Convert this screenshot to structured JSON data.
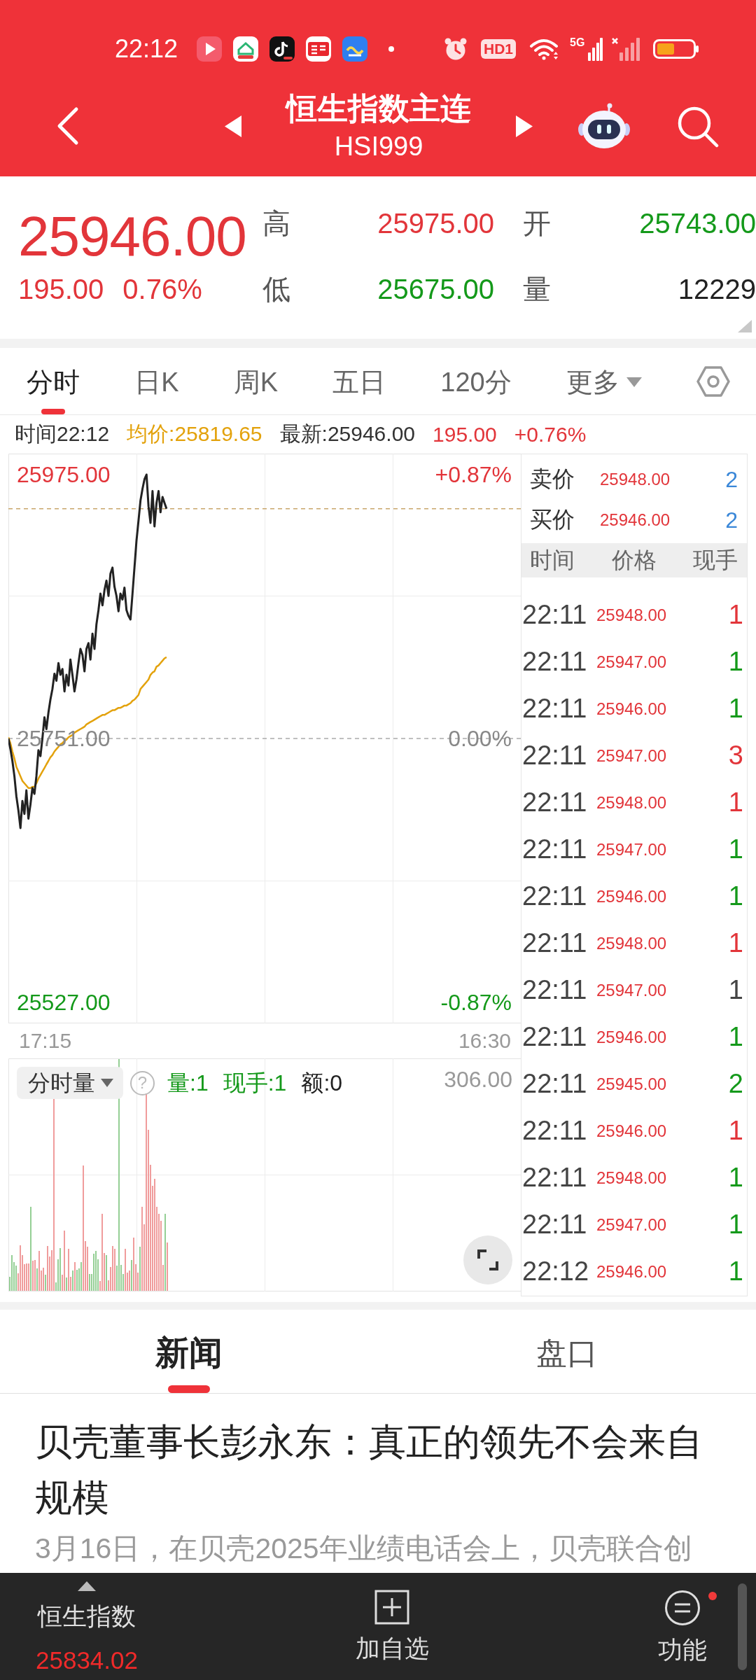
{
  "status_bar": {
    "time": "22:12",
    "hd_badge": "HD1",
    "network": "5G"
  },
  "header": {
    "title": "恒生指数主连",
    "code": "HSI999"
  },
  "quote": {
    "price": "25946.00",
    "change": "195.00",
    "change_percent": "0.76%",
    "rising": true,
    "stats": [
      {
        "label": "高",
        "value": "25975.00",
        "color": "#e2353a"
      },
      {
        "label": "开",
        "value": "25743.00",
        "color": "#14991a"
      },
      {
        "label": "低",
        "value": "25675.00",
        "color": "#14991a"
      },
      {
        "label": "量",
        "value": "12229",
        "color": "#222222"
      }
    ]
  },
  "chart_tabs": [
    {
      "label": "分时",
      "kind": "tab",
      "selected": true
    },
    {
      "label": "日K",
      "kind": "tab",
      "selected": false
    },
    {
      "label": "周K",
      "kind": "tab",
      "selected": false
    },
    {
      "label": "五日",
      "kind": "tab",
      "selected": false
    },
    {
      "label": "120分",
      "kind": "tab",
      "selected": false
    },
    {
      "label": "更多",
      "kind": "menu",
      "selected": false
    }
  ],
  "chart_info": {
    "time": "时间22:12",
    "average": "均价:25819.65",
    "latest": "最新:25946.00",
    "change": "195.00",
    "change_percent": "+0.76%",
    "rising": true
  },
  "price_chart": {
    "chart_data": {
      "type": "line",
      "categories": [
        null,
        null,
        null,
        null,
        null,
        null,
        null,
        null,
        null,
        null,
        null,
        null,
        null,
        null,
        null,
        null,
        null,
        null,
        null,
        null,
        null,
        null,
        null,
        null,
        null,
        null,
        null,
        null,
        null,
        null,
        null,
        null,
        null,
        null,
        null,
        null,
        null,
        null,
        null,
        null,
        null,
        null,
        null,
        null,
        null,
        null,
        null,
        null,
        null,
        null,
        null,
        null,
        null,
        null,
        null,
        null,
        null,
        null,
        null,
        null,
        null,
        null,
        null,
        null,
        null,
        null,
        null,
        null,
        null,
        null,
        null,
        null,
        null,
        null,
        null,
        null,
        null,
        null,
        null,
        null,
        null,
        null,
        null,
        null,
        null,
        null,
        null,
        null,
        null,
        null,
        null,
        null,
        null,
        null,
        null,
        null,
        null,
        null,
        null,
        null,
        null,
        null,
        null,
        null,
        null,
        null,
        null,
        null,
        null,
        null,
        null,
        null,
        null,
        null,
        null,
        null,
        null,
        null,
        null,
        null,
        null,
        null,
        null,
        null,
        null,
        null,
        null,
        null,
        null,
        null,
        null,
        null,
        null,
        null,
        null,
        null,
        null,
        null,
        null,
        null,
        null,
        null,
        null,
        null,
        null,
        null,
        null,
        null,
        null,
        null,
        null,
        null,
        null,
        null,
        null,
        null,
        null,
        null,
        null,
        null,
        null,
        null,
        null,
        null,
        null,
        null,
        null,
        null,
        null,
        null,
        null,
        null,
        null,
        null,
        null,
        null,
        null,
        null,
        null,
        null,
        null,
        null,
        null,
        null,
        null,
        null,
        null,
        null,
        null,
        null,
        null,
        null,
        null,
        null,
        null,
        null,
        null,
        null,
        null,
        null,
        null,
        null,
        null,
        null,
        null,
        null,
        null,
        null,
        null,
        null,
        null,
        null,
        null,
        null,
        null,
        null,
        null,
        null,
        null,
        null,
        null,
        null,
        null,
        null,
        null,
        null,
        null,
        null,
        null,
        null,
        null,
        null,
        null,
        null,
        null,
        null,
        null,
        null,
        null,
        null,
        null,
        null,
        null,
        null,
        null,
        null,
        null,
        null,
        null,
        null,
        null,
        null,
        null,
        null,
        null,
        null,
        null
      ],
      "series": [
        {
          "color": "#222222",
          "values": [
            25751,
            25742,
            25732,
            25719,
            25702,
            25690,
            25675,
            25698,
            25687,
            25707,
            25683,
            25695,
            25709,
            25704,
            25719,
            25741,
            25736,
            25751,
            25769,
            25759,
            25773,
            25784,
            25793,
            25806,
            25800,
            25815,
            25805,
            25810,
            25791,
            25805,
            25796,
            25818,
            25805,
            25791,
            25801,
            25815,
            25827,
            25822,
            25808,
            25827,
            25832,
            25818,
            25840,
            25827,
            25848,
            25860,
            25874,
            25864,
            25877,
            25885,
            25872,
            25891,
            25896,
            25880,
            25872,
            25859,
            25874,
            25869,
            25879,
            25860,
            25855,
            25852,
            25874,
            25896,
            25919,
            25936,
            25953,
            25963,
            25971,
            25975,
            25948,
            25934,
            25961,
            25931,
            25951,
            25961,
            25943,
            25956,
            25951,
            25946,
            null,
            null,
            null,
            null,
            null,
            null,
            null,
            null,
            null,
            null,
            null,
            null,
            null,
            null,
            null,
            null,
            null,
            null,
            null,
            null,
            null,
            null,
            null,
            null,
            null,
            null,
            null,
            null,
            null,
            null,
            null,
            null,
            null,
            null,
            null,
            null,
            null,
            null,
            null,
            null,
            null,
            null,
            null,
            null,
            null,
            null,
            null,
            null,
            null,
            null,
            null,
            null,
            null,
            null,
            null,
            null,
            null,
            null,
            null,
            null,
            null,
            null,
            null,
            null,
            null,
            null,
            null,
            null,
            null,
            null,
            null,
            null,
            null,
            null,
            null,
            null,
            null,
            null,
            null,
            null,
            null,
            null,
            null,
            null,
            null,
            null,
            null,
            null,
            null,
            null,
            null,
            null,
            null,
            null,
            null,
            null,
            null,
            null,
            null,
            null,
            null,
            null,
            null,
            null,
            null,
            null,
            null,
            null,
            null,
            null,
            null,
            null,
            null,
            null,
            null,
            null,
            null,
            null,
            null,
            null,
            null,
            null,
            null,
            null,
            null,
            null,
            null,
            null,
            null,
            null,
            null,
            null,
            null,
            null,
            null,
            null,
            null,
            null,
            null,
            null,
            null,
            null,
            null,
            null,
            null,
            null,
            null,
            null,
            null,
            null,
            null,
            null,
            null,
            null,
            null,
            null,
            null,
            null,
            null,
            null,
            null,
            null,
            null,
            null,
            null,
            null,
            null,
            null,
            null,
            null,
            null,
            null,
            null,
            null,
            null,
            null,
            null
          ]
        },
        {
          "color": "#e3a20c",
          "values": [
            25752,
            25747,
            25740,
            25734,
            25727,
            25723,
            25719,
            25715,
            25713,
            25711,
            25709,
            25709,
            25710,
            25710,
            25713,
            25717,
            25720,
            25723,
            25726,
            25729,
            25732,
            25735,
            25737,
            25740,
            25742,
            25744,
            25746,
            25747,
            25749,
            25750,
            25752,
            25753,
            25754,
            25756,
            25757,
            25758,
            25759,
            25760,
            25761,
            25763,
            25764,
            25765,
            25766,
            25767,
            25768,
            25769,
            25770,
            25771,
            25771,
            25772,
            25773,
            25774,
            25775,
            25775,
            25776,
            25777,
            25777,
            25778,
            25779,
            25779,
            25780,
            25781,
            25783,
            25784,
            25786,
            25788,
            25793,
            25795,
            25797,
            25799,
            25801,
            25805,
            25807,
            25808,
            25812,
            25813,
            25815,
            25817,
            25819,
            25820,
            null,
            null,
            null,
            null,
            null,
            null,
            null,
            null,
            null,
            null,
            null,
            null,
            null,
            null,
            null,
            null,
            null,
            null,
            null,
            null,
            null,
            null,
            null,
            null,
            null,
            null,
            null,
            null,
            null,
            null,
            null,
            null,
            null,
            null,
            null,
            null,
            null,
            null,
            null,
            null,
            null,
            null,
            null,
            null,
            null,
            null,
            null,
            null,
            null,
            null,
            null,
            null,
            null,
            null,
            null,
            null,
            null,
            null,
            null,
            null,
            null,
            null,
            null,
            null,
            null,
            null,
            null,
            null,
            null,
            null,
            null,
            null,
            null,
            null,
            null,
            null,
            null,
            null,
            null,
            null,
            null,
            null,
            null,
            null,
            null,
            null,
            null,
            null,
            null,
            null,
            null,
            null,
            null,
            null,
            null,
            null,
            null,
            null,
            null,
            null,
            null,
            null,
            null,
            null,
            null,
            null,
            null,
            null,
            null,
            null,
            null,
            null,
            null,
            null,
            null,
            null,
            null,
            null,
            null,
            null,
            null,
            null,
            null,
            null,
            null,
            null,
            null,
            null,
            null,
            null,
            null,
            null,
            null,
            null,
            null,
            null,
            null,
            null,
            null,
            null,
            null,
            null,
            null,
            null,
            null,
            null,
            null,
            null,
            null,
            null,
            null,
            null,
            null,
            null,
            null,
            null,
            null,
            null,
            null,
            null,
            null,
            null,
            null,
            null,
            null,
            null,
            null,
            null,
            null,
            null,
            null,
            null,
            null,
            null,
            null,
            null,
            null
          ]
        }
      ],
      "ylim": [
        25509.2,
        25992.8
      ],
      "yticks": [
        {
          "value": 25527,
          "label": "25527.00"
        },
        {
          "value": 25751,
          "label": "25751.00"
        },
        {
          "value": 25975,
          "label": "25975.00"
        }
      ],
      "ref_lines": [
        {
          "axis": "y",
          "value": 25751,
          "color": "#aaaaaa"
        },
        {
          "axis": "y",
          "value": 25946,
          "color": "#c9a56b"
        }
      ]
    },
    "right_axis": [
      {
        "label": "+0.87%",
        "color": "#e2353a"
      },
      {
        "label": "0.00%",
        "color": "#888888"
      },
      {
        "label": "-0.87%",
        "color": "#14991a"
      }
    ],
    "time_axis": [
      "17:15",
      "16:30"
    ]
  },
  "volume_chart": {
    "selector": "分时量",
    "help": "?",
    "volume": "量:1",
    "current": "现手:1",
    "amount": "额:0",
    "rising": false,
    "max": "306.00"
  },
  "order_book": {
    "quotes": [
      {
        "label": "卖价",
        "price": "25948.00",
        "size": "2"
      },
      {
        "label": "买价",
        "price": "25946.00",
        "size": "2"
      }
    ],
    "columns": [
      "时间",
      "价格",
      "现手"
    ],
    "trades": [
      {
        "time": "22:11",
        "price": "25948.00",
        "volume": "1",
        "color": "#e2353a"
      },
      {
        "time": "22:11",
        "price": "25947.00",
        "volume": "1",
        "color": "#14991a"
      },
      {
        "time": "22:11",
        "price": "25946.00",
        "volume": "1",
        "color": "#14991a"
      },
      {
        "time": "22:11",
        "price": "25947.00",
        "volume": "3",
        "color": "#e2353a"
      },
      {
        "time": "22:11",
        "price": "25948.00",
        "volume": "1",
        "color": "#e2353a"
      },
      {
        "time": "22:11",
        "price": "25947.00",
        "volume": "1",
        "color": "#14991a"
      },
      {
        "time": "22:11",
        "price": "25946.00",
        "volume": "1",
        "color": "#14991a"
      },
      {
        "time": "22:11",
        "price": "25948.00",
        "volume": "1",
        "color": "#e2353a"
      },
      {
        "time": "22:11",
        "price": "25947.00",
        "volume": "1",
        "color": "#444444"
      },
      {
        "time": "22:11",
        "price": "25946.00",
        "volume": "1",
        "color": "#14991a"
      },
      {
        "time": "22:11",
        "price": "25945.00",
        "volume": "2",
        "color": "#14991a"
      },
      {
        "time": "22:11",
        "price": "25946.00",
        "volume": "1",
        "color": "#e2353a"
      },
      {
        "time": "22:11",
        "price": "25948.00",
        "volume": "1",
        "color": "#14991a"
      },
      {
        "time": "22:11",
        "price": "25947.00",
        "volume": "1",
        "color": "#14991a"
      },
      {
        "time": "22:12",
        "price": "25946.00",
        "volume": "1",
        "color": "#14991a"
      }
    ]
  },
  "news_tabs": [
    {
      "label": "新闻",
      "selected": true
    },
    {
      "label": "盘口",
      "selected": false
    }
  ],
  "news": {
    "headline": "贝壳董事长彭永东：真正的领先不会来自规模",
    "summary": "3月16日，在贝壳2025年业绩电话会上，贝壳联合创"
  },
  "bottom_nav": {
    "index_name": "恒生指数",
    "index_value": "25834.02",
    "rising": true,
    "items": [
      {
        "kind": "add",
        "label": "加自选",
        "notification": false
      },
      {
        "kind": "functions",
        "label": "功能",
        "notification": true
      }
    ]
  }
}
